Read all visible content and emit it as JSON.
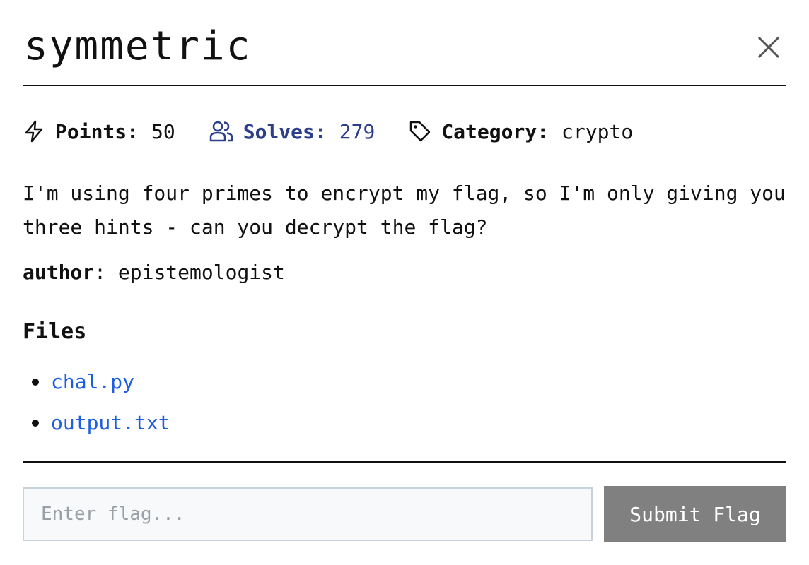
{
  "challenge": {
    "title": "symmetric",
    "close_icon": "close-icon"
  },
  "meta": {
    "points_icon": "lightning-icon",
    "points_label": "Points:",
    "points_value": "50",
    "solves_icon": "users-icon",
    "solves_label": "Solves:",
    "solves_value": "279",
    "category_icon": "tag-icon",
    "category_label": "Category:",
    "category_value": "crypto"
  },
  "description": "I'm using four primes to encrypt my flag, so I'm only giving you three hints - can you decrypt the flag?",
  "author": {
    "label": "author",
    "separator": ": ",
    "name": "epistemologist"
  },
  "files": {
    "heading": "Files",
    "items": [
      {
        "name": "chal.py"
      },
      {
        "name": "output.txt"
      }
    ]
  },
  "flag_form": {
    "placeholder": "Enter flag...",
    "value": "",
    "submit_label": "Submit Flag"
  },
  "colors": {
    "text": "#111111",
    "solves_accent": "#2b3f8a",
    "link": "#1d5fe0",
    "button_bg": "#808080",
    "input_border": "#c9d1d9",
    "input_bg": "#f8f9fb"
  }
}
